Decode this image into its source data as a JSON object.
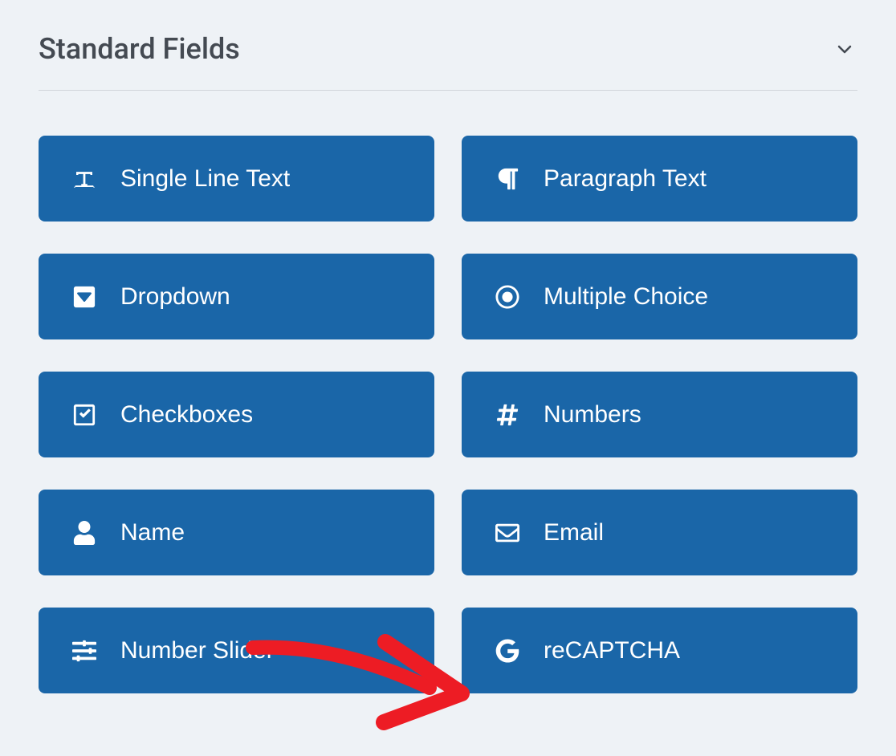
{
  "header": {
    "title": "Standard Fields"
  },
  "fields": [
    {
      "id": "single-line-text",
      "label": "Single Line Text",
      "icon": "text-icon"
    },
    {
      "id": "paragraph-text",
      "label": "Paragraph Text",
      "icon": "paragraph-icon"
    },
    {
      "id": "dropdown",
      "label": "Dropdown",
      "icon": "dropdown-icon"
    },
    {
      "id": "multiple-choice",
      "label": "Multiple Choice",
      "icon": "radio-icon"
    },
    {
      "id": "checkboxes",
      "label": "Checkboxes",
      "icon": "checkbox-icon"
    },
    {
      "id": "numbers",
      "label": "Numbers",
      "icon": "hash-icon"
    },
    {
      "id": "name",
      "label": "Name",
      "icon": "person-icon"
    },
    {
      "id": "email",
      "label": "Email",
      "icon": "envelope-icon"
    },
    {
      "id": "number-slider",
      "label": "Number Slider",
      "icon": "sliders-icon"
    },
    {
      "id": "recaptcha",
      "label": "reCAPTCHA",
      "icon": "google-icon"
    }
  ],
  "annotation": {
    "target": "recaptcha",
    "color": "#ed1c24"
  }
}
